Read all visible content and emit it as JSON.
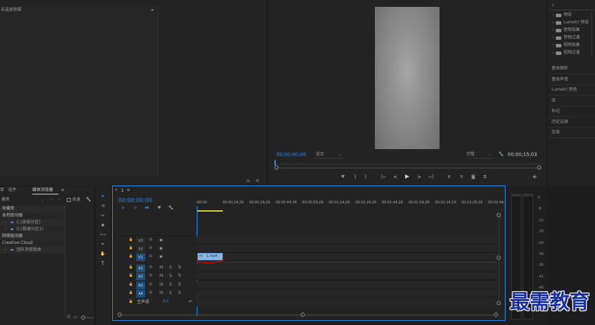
{
  "source_panel": {
    "title": "未选择剪辑",
    "tabs": [
      "目",
      "组件"
    ]
  },
  "program_monitor": {
    "timecode_left": "00;00;00;00",
    "zoom": "适合",
    "quality": "完整",
    "timecode_right": "00;00;15;03"
  },
  "effects_panel": {
    "tree": [
      "预设",
      "Lumetri 预设",
      "音频效果",
      "音频过渡",
      "视频效果",
      "视频过渡"
    ],
    "sections": [
      "基本图形",
      "基本声音",
      "Lumetri 颜色",
      "库",
      "标记",
      "历史记录",
      "信息"
    ]
  },
  "media_browser": {
    "tab_projects": "目",
    "tab_assets": "组件",
    "tab_browser": "媒体浏览器",
    "favorites_label": "藏夹",
    "ingest_label": "收录",
    "tree": [
      {
        "label": "收藏夹",
        "indent": 0
      },
      {
        "label": "本地驱动器",
        "indent": 0
      },
      {
        "label": "C:(系统分区)",
        "indent": 1
      },
      {
        "label": "D:(数据分区1)",
        "indent": 1
      },
      {
        "label": "网络驱动器",
        "indent": 0
      },
      {
        "label": "Creative Cloud",
        "indent": 0
      },
      {
        "label": "团队项目版本",
        "indent": 1
      }
    ]
  },
  "timeline": {
    "sequence_label": "1",
    "timecode": "00;00;00;00",
    "ruler": [
      ":00;00",
      "00;00;14;29",
      "00;00;29;29",
      "00;00;44;28",
      "00;00;59;28",
      "00;01;14;29",
      "00;01;29;29",
      "00;01;44;28",
      "00;01;59;28",
      "00;02;14;29",
      "00;02;29;29",
      "00;02;44;"
    ],
    "video_tracks": [
      "V3",
      "V2",
      "V1"
    ],
    "audio_tracks": [
      "A1",
      "A2",
      "A3",
      "A4"
    ],
    "mute_label": "M",
    "solo_label": "S",
    "master_label": "主声道",
    "master_value": "0.0",
    "clip_name": "1.mp4"
  },
  "audio_meter": {
    "ticks": [
      "0",
      "-6",
      "-12",
      "-18",
      "-24",
      "-30",
      "-36",
      "-42",
      "-48",
      "-54"
    ]
  },
  "watermark": "最需教育",
  "colors": {
    "accent": "#2d8ceb",
    "clip": "#8cb4dd",
    "annotation": "#d40000",
    "watermark": "#1a2fa0"
  }
}
